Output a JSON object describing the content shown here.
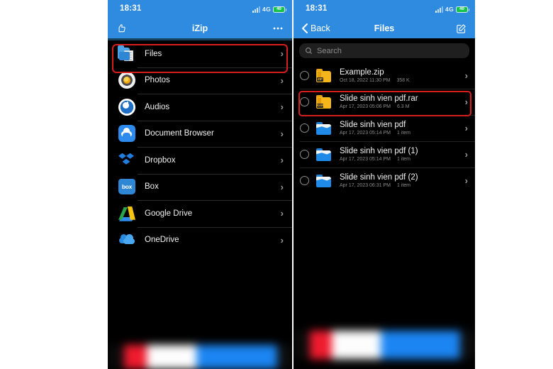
{
  "left_phone": {
    "status": {
      "time": "18:31",
      "network": "4G",
      "battery_label": "40",
      "signal_icon": "signal-bars-icon",
      "battery_icon": "battery-icon"
    },
    "nav": {
      "title": "iZip",
      "left_icon": "thumbs-up-icon",
      "right_icon": "more-dots-icon"
    },
    "menu": [
      {
        "label": "Files",
        "icon": "files-folder-icon",
        "highlighted": true
      },
      {
        "label": "Photos",
        "icon": "photos-icon",
        "highlighted": false
      },
      {
        "label": "Audios",
        "icon": "audios-icon",
        "highlighted": false
      },
      {
        "label": "Document Browser",
        "icon": "document-browser-icon",
        "highlighted": false
      },
      {
        "label": "Dropbox",
        "icon": "dropbox-icon",
        "highlighted": false
      },
      {
        "label": "Box",
        "icon": "box-icon",
        "highlighted": false
      },
      {
        "label": "Google Drive",
        "icon": "google-drive-icon",
        "highlighted": false
      },
      {
        "label": "OneDrive",
        "icon": "onedrive-icon",
        "highlighted": false
      }
    ],
    "box_icon_text": "box"
  },
  "right_phone": {
    "status": {
      "time": "18:31",
      "network": "4G",
      "battery_label": "40",
      "signal_icon": "signal-bars-icon",
      "battery_icon": "battery-icon"
    },
    "nav": {
      "back_label": "Back",
      "title": "Files",
      "back_icon": "chevron-left-icon",
      "right_icon": "compose-icon"
    },
    "search": {
      "placeholder": "Search",
      "icon": "search-icon"
    },
    "files": [
      {
        "name": "Example.zip",
        "date": "Oct 18, 2022 11:30 PM",
        "size": "358 K",
        "icon": "zip-folder-icon",
        "badge": "ZIP",
        "highlighted": false
      },
      {
        "name": "Slide sinh vien pdf.rar",
        "date": "Apr 17, 2023 05:06 PM",
        "size": "6.3 M",
        "icon": "rar-folder-icon",
        "badge": "RAR",
        "highlighted": true
      },
      {
        "name": "Slide sinh vien pdf",
        "date": "Apr 17, 2023 05:14 PM",
        "size": "1 item",
        "icon": "blue-folder-icon",
        "badge": "",
        "highlighted": false
      },
      {
        "name": "Slide sinh vien pdf (1)",
        "date": "Apr 17, 2023 05:14 PM",
        "size": "1 item",
        "icon": "blue-folder-icon",
        "badge": "",
        "highlighted": false
      },
      {
        "name": "Slide sinh vien pdf (2)",
        "date": "Apr 17, 2023 06:31 PM",
        "size": "1 item",
        "icon": "blue-folder-icon",
        "badge": "",
        "highlighted": false
      }
    ]
  },
  "colors": {
    "header_blue": "#2E8BE0",
    "highlight_red": "#d81d1d",
    "screen_black": "#000000",
    "folder_yellow": "#f5b61b",
    "folder_blue": "#1f8ae8"
  }
}
